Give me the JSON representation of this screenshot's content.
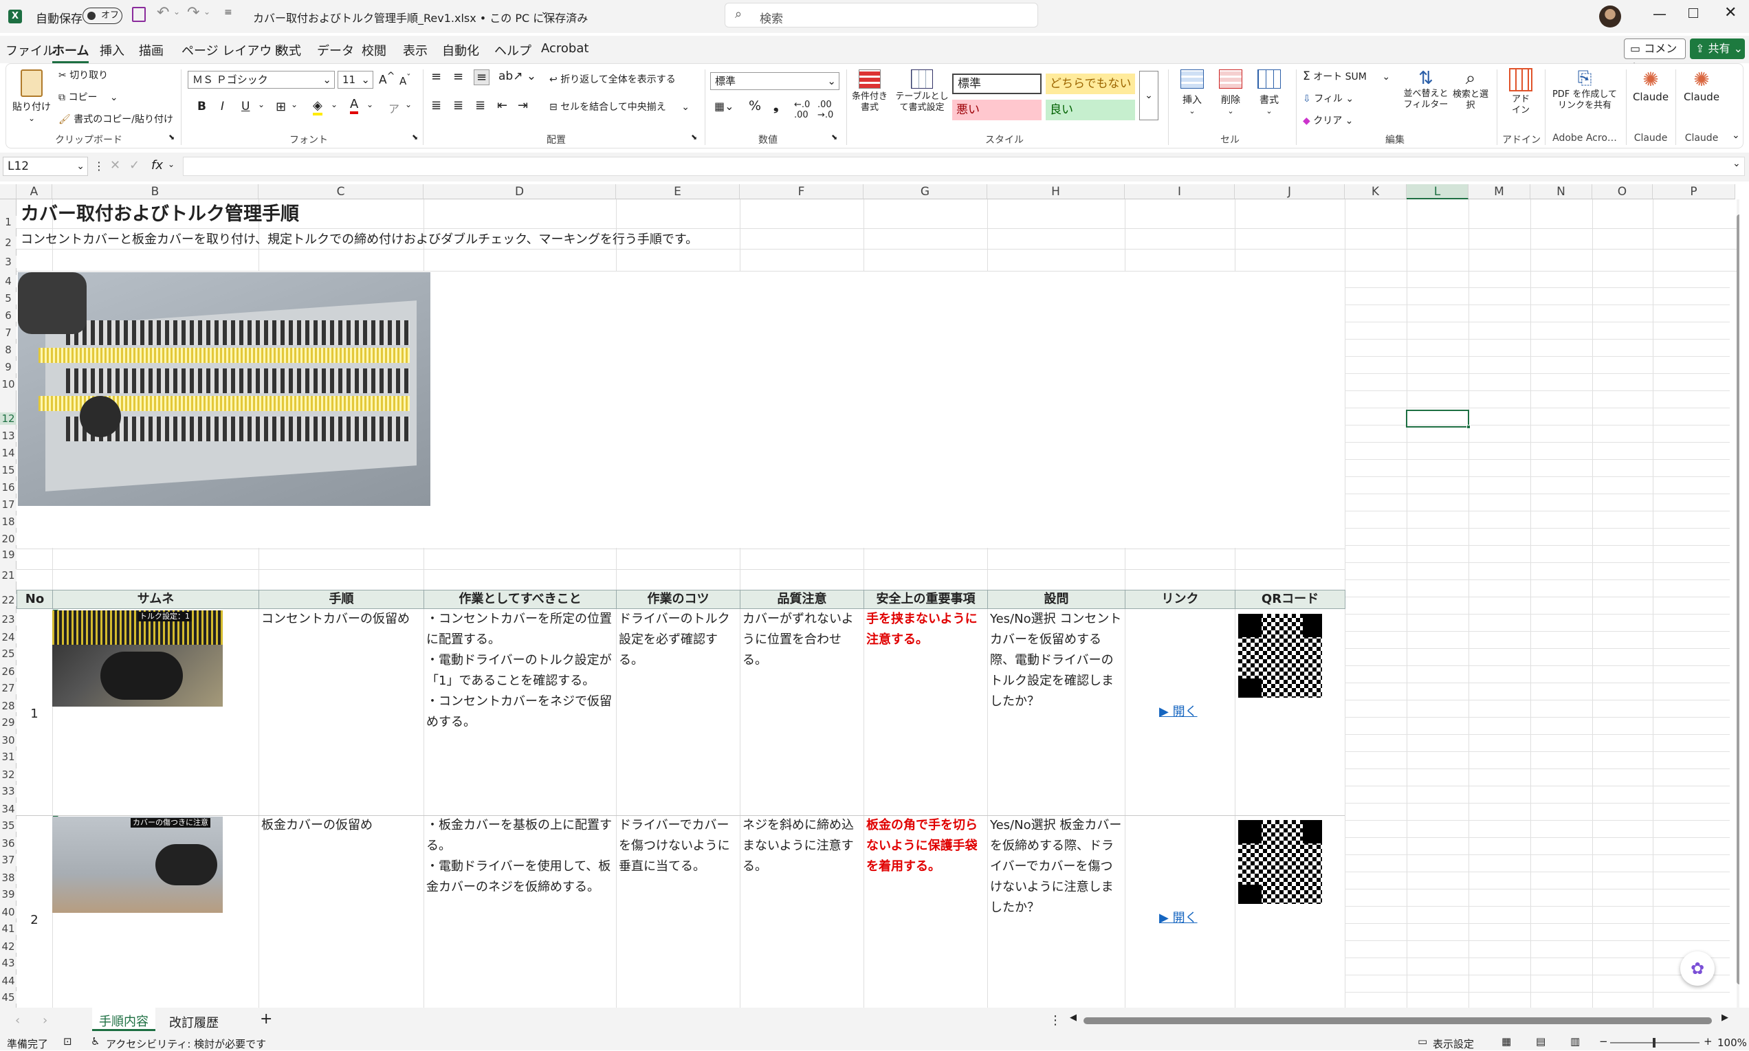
{
  "titlebar": {
    "autosave_label": "自動保存",
    "autosave_state": "オフ",
    "filename": "カバー取付およびトルク管理手順_Rev1.xlsx • この PC に保存済み",
    "search_placeholder": "検索"
  },
  "menu": [
    "ファイル",
    "ホーム",
    "挿入",
    "描画",
    "ページ レイアウト",
    "数式",
    "データ",
    "校閲",
    "表示",
    "自動化",
    "ヘルプ",
    "Acrobat"
  ],
  "menu_right": {
    "comment": "コメント",
    "share": "共有"
  },
  "ribbon": {
    "clipboard": {
      "paste": "貼り付け",
      "cut": "切り取り",
      "copy": "コピー",
      "format_painter": "書式のコピー/貼り付け",
      "label": "クリップボード"
    },
    "font": {
      "name": "ＭＳ Ｐゴシック",
      "size": "11",
      "bold": "B",
      "italic": "I",
      "underline": "U",
      "label": "フォント"
    },
    "alignment": {
      "wrap": "折り返して全体を表示する",
      "merge": "セルを結合して中央揃え",
      "label": "配置"
    },
    "number": {
      "format": "標準",
      "label": "数値"
    },
    "styles": {
      "conditional": "条件付き書式",
      "table": "テーブルとして書式設定",
      "normal": "標準",
      "neutral": "どちらでもない",
      "bad": "悪い",
      "good": "良い",
      "label": "スタイル"
    },
    "cells": {
      "insert": "挿入",
      "delete": "削除",
      "format": "書式",
      "label": "セル"
    },
    "editing": {
      "autosum": "オート SUM",
      "fill": "フィル",
      "clear": "クリア",
      "sort": "並べ替えとフィルター",
      "find": "検索と選択",
      "label": "編集"
    },
    "addins": {
      "addin": "アドイン",
      "label": "アドイン"
    },
    "adobe": {
      "pdf": "PDF を作成してリンクを共有",
      "label": "Adobe Acro…"
    },
    "claude1": {
      "btn": "Claude",
      "label": "Claude"
    },
    "claude2": {
      "btn": "Claude",
      "label": "Claude"
    }
  },
  "namebox": "L12",
  "fx": "fx",
  "columns": [
    "A",
    "B",
    "C",
    "D",
    "E",
    "F",
    "G",
    "H",
    "I",
    "J",
    "K",
    "L",
    "M",
    "N",
    "O",
    "P"
  ],
  "rows": [
    "1",
    "2",
    "3",
    "4",
    "5",
    "6",
    "7",
    "8",
    "9",
    "10",
    "12",
    "13",
    "14",
    "15",
    "16",
    "17",
    "18",
    "20",
    "19",
    "21",
    "22",
    "23",
    "24",
    "25",
    "26",
    "27",
    "28",
    "29",
    "30",
    "31",
    "32",
    "33",
    "34",
    "35",
    "36",
    "37",
    "38",
    "39",
    "40",
    "41",
    "42",
    "43",
    "44",
    "45"
  ],
  "sheet": {
    "title": "カバー取付およびトルク管理手順",
    "description": "コンセントカバーと板金カバーを取り付け、規定トルクでの締め付けおよびダブルチェック、マーキングを行う手順です。",
    "headers": [
      "No",
      "サムネ",
      "手順",
      "作業としてすべきこと",
      "作業のコツ",
      "品質注意",
      "安全上の重要事項",
      "設問",
      "リンク",
      "QRコード"
    ],
    "rows": [
      {
        "no": "1",
        "thumb_caption": "トルク設定：1",
        "step": "コンセントカバーの仮留め",
        "todo": [
          "・コンセントカバーを所定の位置に配置する。",
          "・電動ドライバーのトルク設定が「1」であることを確認する。",
          "・コンセントカバーをネジで仮留めする。"
        ],
        "tip": "ドライバーのトルク設定を必ず確認する。",
        "quality": "カバーがずれないように位置を合わせる。",
        "safety": "手を挟まないように注意する。",
        "question": "Yes/No選択 コンセントカバーを仮留めする際、電動ドライバーのトルク設定を確認しましたか？",
        "link": "▶ 開く"
      },
      {
        "no": "2",
        "thumb_caption": "カバーの傷つきに注意",
        "step": "板金カバーの仮留め",
        "todo": [
          "・板金カバーを基板の上に配置する。",
          "・電動ドライバーを使用して、板金カバーのネジを仮締めする。"
        ],
        "tip": "ドライバーでカバーを傷つけないように垂直に当てる。",
        "quality": "ネジを斜めに締め込まないように注意する。",
        "safety": "板金の角で手を切らないように保護手袋を着用する。",
        "question": "Yes/No選択 板金カバーを仮締めする際、ドライバーでカバーを傷つけないように注意しましたか？",
        "link": "▶ 開く"
      }
    ]
  },
  "tabs": [
    "手順内容",
    "改訂履歴"
  ],
  "status": {
    "ready": "準備完了",
    "accessibility": "アクセシビリティ: 検討が必要です",
    "display": "表示設定",
    "zoom": "100%"
  }
}
